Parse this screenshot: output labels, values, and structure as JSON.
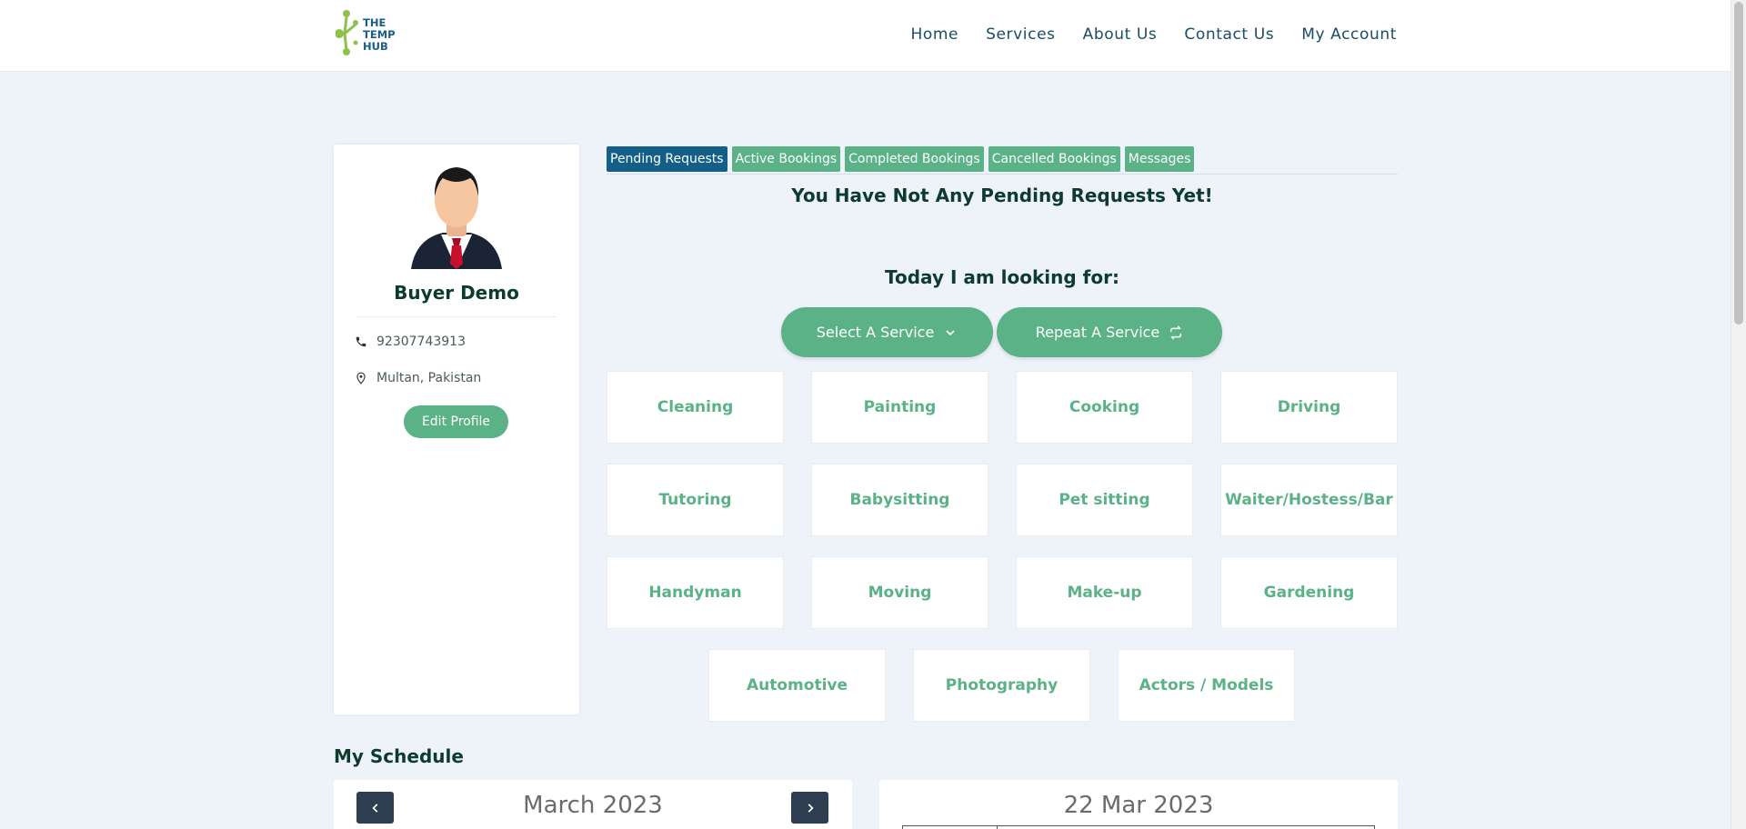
{
  "header": {
    "logo": {
      "line1": "THE",
      "line2": "TEMP",
      "line3": "HUB"
    },
    "nav": [
      "Home",
      "Services",
      "About Us",
      "Contact Us",
      "My Account"
    ]
  },
  "profile": {
    "name": "Buyer Demo",
    "phone": "92307743913",
    "location": "Multan, Pakistan",
    "edit_label": "Edit Profile"
  },
  "tabs": [
    {
      "label": "Pending Requests",
      "active": true
    },
    {
      "label": "Active Bookings",
      "active": false
    },
    {
      "label": "Completed Bookings",
      "active": false
    },
    {
      "label": "Cancelled Bookings",
      "active": false
    },
    {
      "label": "Messages",
      "active": false
    }
  ],
  "main": {
    "empty_message": "You Have Not Any Pending Requests Yet!",
    "looking_for": "Today I am looking for:",
    "select_service": "Select A Service",
    "repeat_service": "Repeat A Service"
  },
  "services": [
    "Cleaning",
    "Painting",
    "Cooking",
    "Driving",
    "Tutoring",
    "Babysitting",
    "Pet sitting",
    "Waiter/Hostess/Bar",
    "Handyman",
    "Moving",
    "Make-up",
    "Gardening",
    "Automotive",
    "Photography",
    "Actors / Models"
  ],
  "schedule": {
    "title": "My Schedule",
    "month": "March 2023",
    "day": "22 Mar 2023"
  },
  "colors": {
    "accent": "#5ab286",
    "active_tab": "#135f87",
    "nav_dark": "#2c3e50",
    "background": "#eef3fa"
  }
}
